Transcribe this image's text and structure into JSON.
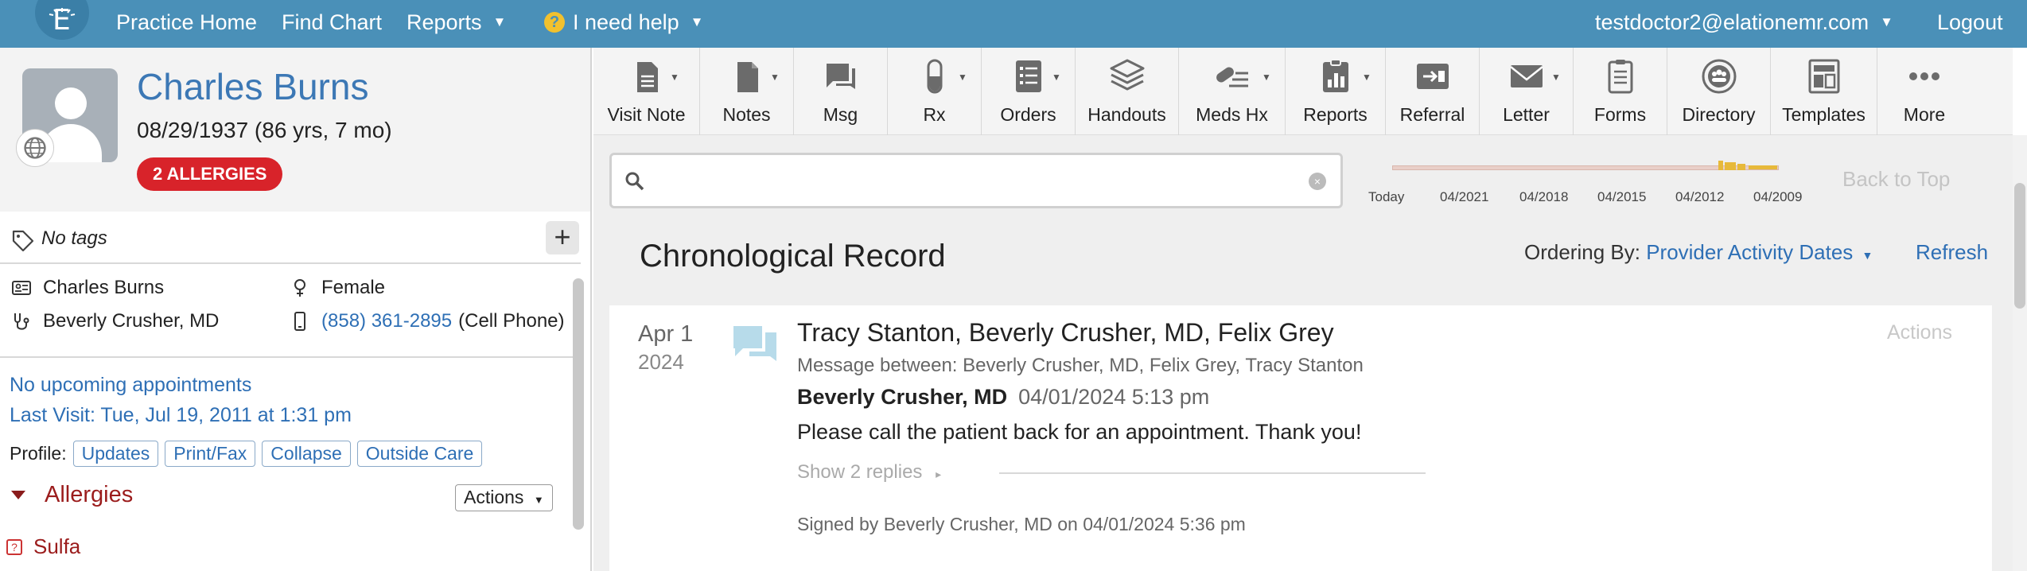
{
  "topbar": {
    "logo_letter": "E",
    "nav": [
      "Practice Home",
      "Find Chart",
      "Reports",
      "I need help"
    ],
    "user": "testdoctor2@elationemr.com",
    "logout": "Logout"
  },
  "patient": {
    "name": "Charles Burns",
    "dob": "08/29/1937 (86 yrs, 7 mo)",
    "allergy_badge": "2 ALLERGIES",
    "tags": "No tags",
    "info": {
      "name": "Charles Burns",
      "sex": "Female",
      "provider": "Beverly Crusher, MD",
      "phone": "(858) 361-2895",
      "phone_type": "(Cell Phone)"
    },
    "appointments": "No upcoming appointments",
    "last_visit": "Last Visit: Tue, Jul 19, 2011 at 1:31 pm",
    "profile_label": "Profile:",
    "profile_buttons": [
      "Updates",
      "Print/Fax",
      "Collapse",
      "Outside Care"
    ],
    "allergies_title": "Allergies",
    "allergies_actions": "Actions",
    "allergy_items": [
      "Sulfa"
    ]
  },
  "toolbar": [
    {
      "label": "Visit Note",
      "icon": "visit-note-icon"
    },
    {
      "label": "Notes",
      "icon": "notes-icon"
    },
    {
      "label": "Msg",
      "icon": "message-icon"
    },
    {
      "label": "Rx",
      "icon": "pill-icon"
    },
    {
      "label": "Orders",
      "icon": "orders-icon"
    },
    {
      "label": "Handouts",
      "icon": "handouts-icon"
    },
    {
      "label": "Meds Hx",
      "icon": "meds-history-icon"
    },
    {
      "label": "Reports",
      "icon": "reports-icon"
    },
    {
      "label": "Referral",
      "icon": "referral-icon"
    },
    {
      "label": "Letter",
      "icon": "letter-icon"
    },
    {
      "label": "Forms",
      "icon": "forms-icon"
    },
    {
      "label": "Directory",
      "icon": "directory-icon"
    },
    {
      "label": "Templates",
      "icon": "templates-icon"
    },
    {
      "label": "More",
      "icon": "more-icon"
    }
  ],
  "search": {
    "placeholder": "",
    "value": ""
  },
  "timeline": {
    "labels": [
      "Today",
      "04/2021",
      "04/2018",
      "04/2015",
      "04/2012",
      "04/2009"
    ],
    "back_to_top": "Back to Top"
  },
  "record": {
    "title": "Chronological Record",
    "ordering_label": "Ordering By:",
    "ordering_value": "Provider Activity Dates",
    "refresh": "Refresh"
  },
  "entry": {
    "date": "Apr 1",
    "year": "2024",
    "participants": "Tracy Stanton, Beverly Crusher, MD, Felix Grey",
    "between": "Message between: Beverly Crusher, MD, Felix Grey, Tracy Stanton",
    "sender": "Beverly Crusher, MD",
    "sent_time": "04/01/2024 5:13 pm",
    "body": "Please call the patient back for an appointment. Thank you!",
    "replies": "Show 2 replies",
    "signed": "Signed by Beverly Crusher, MD on 04/01/2024 5:36 pm",
    "actions": "Actions"
  },
  "colors": {
    "topbar": "#4a90b8",
    "link": "#2e6fb5",
    "allergy_badge": "#d8232a",
    "allergy_text": "#9b1c1c"
  }
}
